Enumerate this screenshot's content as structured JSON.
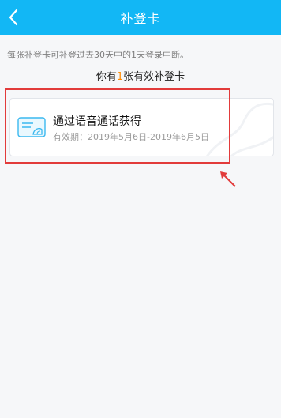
{
  "header": {
    "title": "补登卡",
    "back_icon": "chevron-left-icon"
  },
  "tip": "每张补登卡可补登过去30天中的1天登录中断。",
  "summary": {
    "prefix": "你有",
    "count": "1",
    "suffix": "张有效补登卡"
  },
  "card": {
    "title": "通过语音通话获得",
    "validity": "有效期：2019年5月6日-2019年6月5日",
    "icon": "card-icon"
  },
  "colors": {
    "header": "#12b7f5",
    "accent": "#ff8a00",
    "annotation": "#e23b3b"
  }
}
